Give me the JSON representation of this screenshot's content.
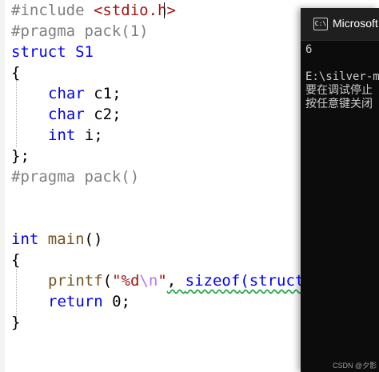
{
  "editor": {
    "lines": {
      "l1": {
        "directive": "#include",
        "header": "<stdio.h>"
      },
      "l2": {
        "text": "#pragma pack(1)"
      },
      "l3": {
        "kw": "struct",
        "name": "S1"
      },
      "l4": {
        "text": "{"
      },
      "l5": {
        "type": "char",
        "rest": "c1;"
      },
      "l6": {
        "type": "char",
        "rest": "c2;"
      },
      "l7": {
        "type": "int",
        "rest": "i;"
      },
      "l8": {
        "text": "};"
      },
      "l9": {
        "text": "#pragma pack()"
      },
      "l10": {
        "type": "int",
        "fn": "main",
        "rest": "()"
      },
      "l11": {
        "text": "{"
      },
      "l12": {
        "fn": "printf",
        "open": "(",
        "fmt": "\"%d",
        "esc": "\\n",
        "fmt_end": "\"",
        "sep": ", ",
        "sizeof": "sizeof",
        "tail": "(struct"
      },
      "l13": {
        "kw": "return",
        "num": "0",
        "end": ";"
      },
      "l14": {
        "text": "}"
      }
    }
  },
  "console": {
    "title": "Microsoft V",
    "icon": "terminal-icon",
    "icon_glyph": "C:\\",
    "output": [
      "6",
      "",
      "E:\\silver-m",
      "要在调试停止",
      "按任意键关闭"
    ],
    "watermark": "CSDN @夕影"
  }
}
